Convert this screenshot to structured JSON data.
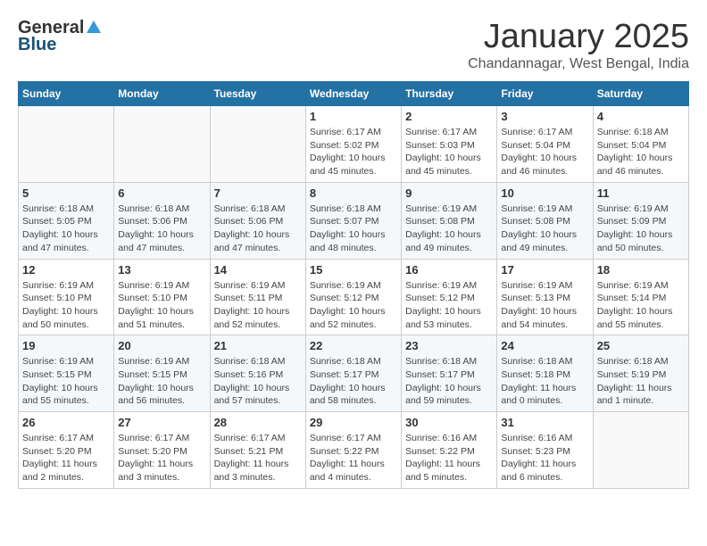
{
  "header": {
    "logo_general": "General",
    "logo_blue": "Blue",
    "month": "January 2025",
    "location": "Chandannagar, West Bengal, India"
  },
  "weekdays": [
    "Sunday",
    "Monday",
    "Tuesday",
    "Wednesday",
    "Thursday",
    "Friday",
    "Saturday"
  ],
  "weeks": [
    [
      {
        "day": "",
        "info": ""
      },
      {
        "day": "",
        "info": ""
      },
      {
        "day": "",
        "info": ""
      },
      {
        "day": "1",
        "info": "Sunrise: 6:17 AM\nSunset: 5:02 PM\nDaylight: 10 hours\nand 45 minutes."
      },
      {
        "day": "2",
        "info": "Sunrise: 6:17 AM\nSunset: 5:03 PM\nDaylight: 10 hours\nand 45 minutes."
      },
      {
        "day": "3",
        "info": "Sunrise: 6:17 AM\nSunset: 5:04 PM\nDaylight: 10 hours\nand 46 minutes."
      },
      {
        "day": "4",
        "info": "Sunrise: 6:18 AM\nSunset: 5:04 PM\nDaylight: 10 hours\nand 46 minutes."
      }
    ],
    [
      {
        "day": "5",
        "info": "Sunrise: 6:18 AM\nSunset: 5:05 PM\nDaylight: 10 hours\nand 47 minutes."
      },
      {
        "day": "6",
        "info": "Sunrise: 6:18 AM\nSunset: 5:06 PM\nDaylight: 10 hours\nand 47 minutes."
      },
      {
        "day": "7",
        "info": "Sunrise: 6:18 AM\nSunset: 5:06 PM\nDaylight: 10 hours\nand 47 minutes."
      },
      {
        "day": "8",
        "info": "Sunrise: 6:18 AM\nSunset: 5:07 PM\nDaylight: 10 hours\nand 48 minutes."
      },
      {
        "day": "9",
        "info": "Sunrise: 6:19 AM\nSunset: 5:08 PM\nDaylight: 10 hours\nand 49 minutes."
      },
      {
        "day": "10",
        "info": "Sunrise: 6:19 AM\nSunset: 5:08 PM\nDaylight: 10 hours\nand 49 minutes."
      },
      {
        "day": "11",
        "info": "Sunrise: 6:19 AM\nSunset: 5:09 PM\nDaylight: 10 hours\nand 50 minutes."
      }
    ],
    [
      {
        "day": "12",
        "info": "Sunrise: 6:19 AM\nSunset: 5:10 PM\nDaylight: 10 hours\nand 50 minutes."
      },
      {
        "day": "13",
        "info": "Sunrise: 6:19 AM\nSunset: 5:10 PM\nDaylight: 10 hours\nand 51 minutes."
      },
      {
        "day": "14",
        "info": "Sunrise: 6:19 AM\nSunset: 5:11 PM\nDaylight: 10 hours\nand 52 minutes."
      },
      {
        "day": "15",
        "info": "Sunrise: 6:19 AM\nSunset: 5:12 PM\nDaylight: 10 hours\nand 52 minutes."
      },
      {
        "day": "16",
        "info": "Sunrise: 6:19 AM\nSunset: 5:12 PM\nDaylight: 10 hours\nand 53 minutes."
      },
      {
        "day": "17",
        "info": "Sunrise: 6:19 AM\nSunset: 5:13 PM\nDaylight: 10 hours\nand 54 minutes."
      },
      {
        "day": "18",
        "info": "Sunrise: 6:19 AM\nSunset: 5:14 PM\nDaylight: 10 hours\nand 55 minutes."
      }
    ],
    [
      {
        "day": "19",
        "info": "Sunrise: 6:19 AM\nSunset: 5:15 PM\nDaylight: 10 hours\nand 55 minutes."
      },
      {
        "day": "20",
        "info": "Sunrise: 6:19 AM\nSunset: 5:15 PM\nDaylight: 10 hours\nand 56 minutes."
      },
      {
        "day": "21",
        "info": "Sunrise: 6:18 AM\nSunset: 5:16 PM\nDaylight: 10 hours\nand 57 minutes."
      },
      {
        "day": "22",
        "info": "Sunrise: 6:18 AM\nSunset: 5:17 PM\nDaylight: 10 hours\nand 58 minutes."
      },
      {
        "day": "23",
        "info": "Sunrise: 6:18 AM\nSunset: 5:17 PM\nDaylight: 10 hours\nand 59 minutes."
      },
      {
        "day": "24",
        "info": "Sunrise: 6:18 AM\nSunset: 5:18 PM\nDaylight: 11 hours\nand 0 minutes."
      },
      {
        "day": "25",
        "info": "Sunrise: 6:18 AM\nSunset: 5:19 PM\nDaylight: 11 hours\nand 1 minute."
      }
    ],
    [
      {
        "day": "26",
        "info": "Sunrise: 6:17 AM\nSunset: 5:20 PM\nDaylight: 11 hours\nand 2 minutes."
      },
      {
        "day": "27",
        "info": "Sunrise: 6:17 AM\nSunset: 5:20 PM\nDaylight: 11 hours\nand 3 minutes."
      },
      {
        "day": "28",
        "info": "Sunrise: 6:17 AM\nSunset: 5:21 PM\nDaylight: 11 hours\nand 3 minutes."
      },
      {
        "day": "29",
        "info": "Sunrise: 6:17 AM\nSunset: 5:22 PM\nDaylight: 11 hours\nand 4 minutes."
      },
      {
        "day": "30",
        "info": "Sunrise: 6:16 AM\nSunset: 5:22 PM\nDaylight: 11 hours\nand 5 minutes."
      },
      {
        "day": "31",
        "info": "Sunrise: 6:16 AM\nSunset: 5:23 PM\nDaylight: 11 hours\nand 6 minutes."
      },
      {
        "day": "",
        "info": ""
      }
    ]
  ]
}
